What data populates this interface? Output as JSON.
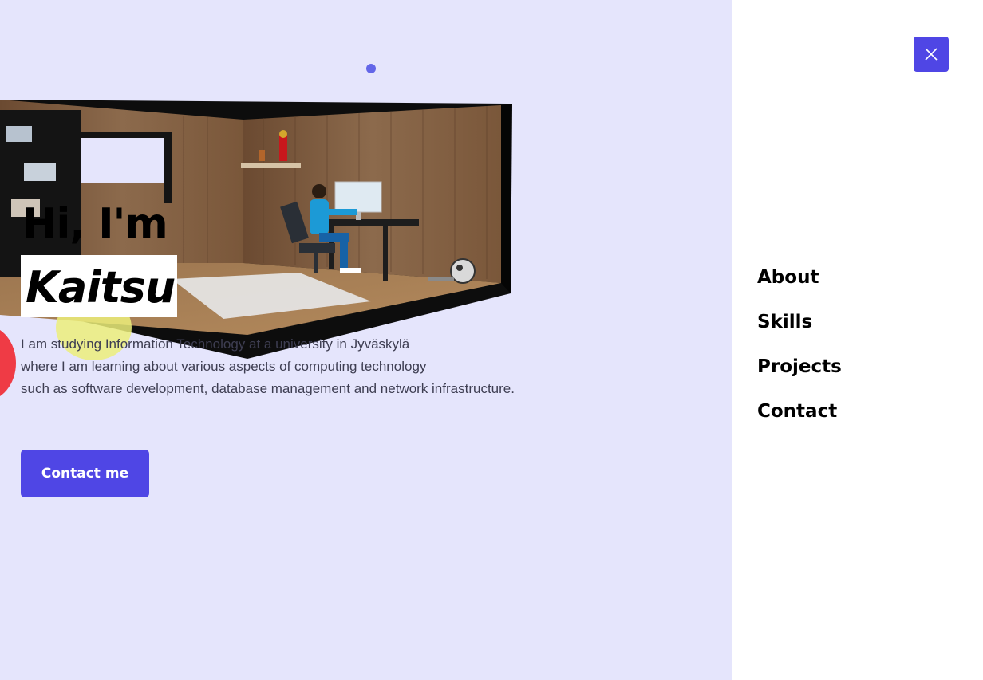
{
  "hero": {
    "greeting": "Hi, I'm",
    "name": "Kaitsu",
    "intro_lines": [
      "I am studying Information Technology at a university in Jyväskylä",
      "where I am learning about various aspects of computing technology",
      "such as software development, database management and network infrastructure."
    ],
    "cta_label": "Contact me",
    "accent_color": "#4f46e5",
    "background_color": "#e5e5fc"
  },
  "menu": {
    "close_icon": "close-icon",
    "items": [
      {
        "label": "About"
      },
      {
        "label": "Skills"
      },
      {
        "label": "Projects"
      },
      {
        "label": "Contact"
      }
    ]
  }
}
